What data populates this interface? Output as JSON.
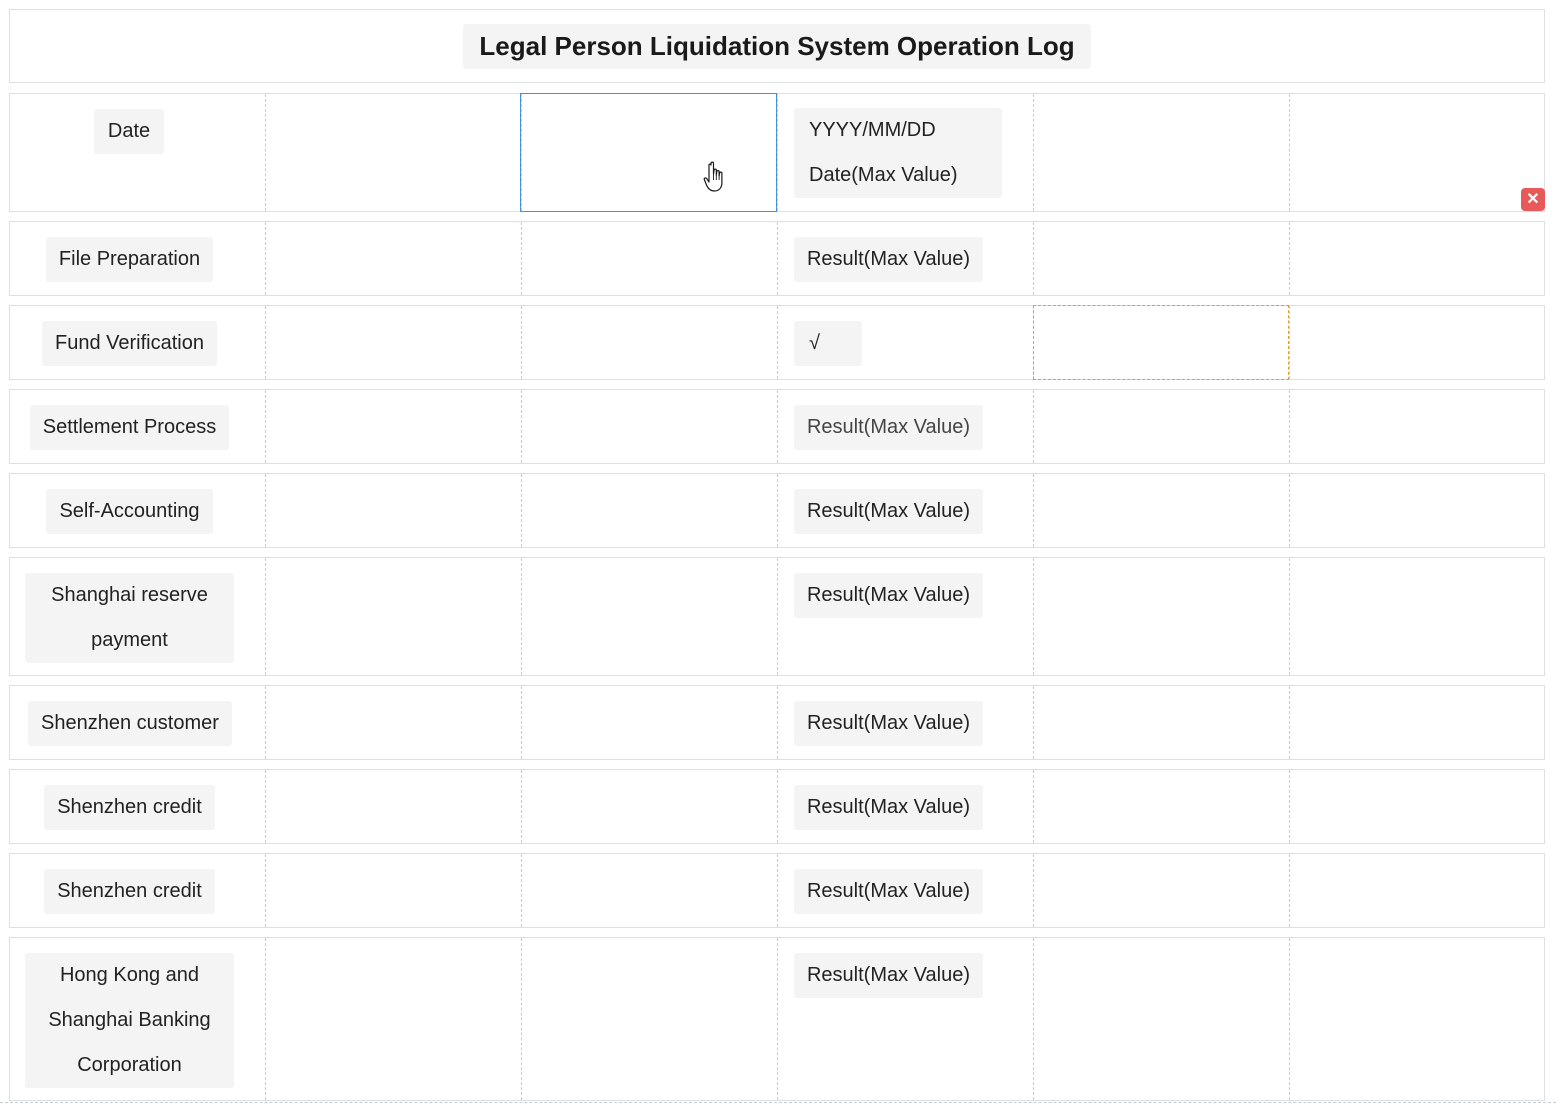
{
  "title": "Legal Person Liquidation System Operation Log",
  "rows": [
    {
      "label": "Date",
      "value_lines": [
        "YYYY/MM/DD",
        "Date(Max Value)"
      ]
    },
    {
      "label": "File Preparation",
      "value": "Result(Max Value)"
    },
    {
      "label": "Fund Verification",
      "value": "√"
    },
    {
      "label": "Settlement Process",
      "value": "Result(Max Value)"
    },
    {
      "label": "Self-Accounting",
      "value": "Result(Max Value)"
    },
    {
      "label_lines": [
        "Shanghai reserve",
        "payment"
      ],
      "value": "Result(Max Value)"
    },
    {
      "label": "Shenzhen customer",
      "value": "Result(Max Value)"
    },
    {
      "label": "Shenzhen credit",
      "value": "Result(Max Value)"
    },
    {
      "label": "Shenzhen credit",
      "value": "Result(Max Value)"
    },
    {
      "label_lines": [
        "Hong Kong and",
        "Shanghai Banking",
        "Corporation"
      ],
      "value": "Result(Max Value)"
    }
  ],
  "controls": {
    "delete_icon": "close-icon",
    "cursor_icon": "hand-pointer-icon",
    "delete_glyph": "✕"
  },
  "colors": {
    "selection_blue": "#4a90d9",
    "selection_orange": "#e0a030",
    "delete_red": "#e85a5a",
    "chip_bg": "#f4f4f4"
  }
}
